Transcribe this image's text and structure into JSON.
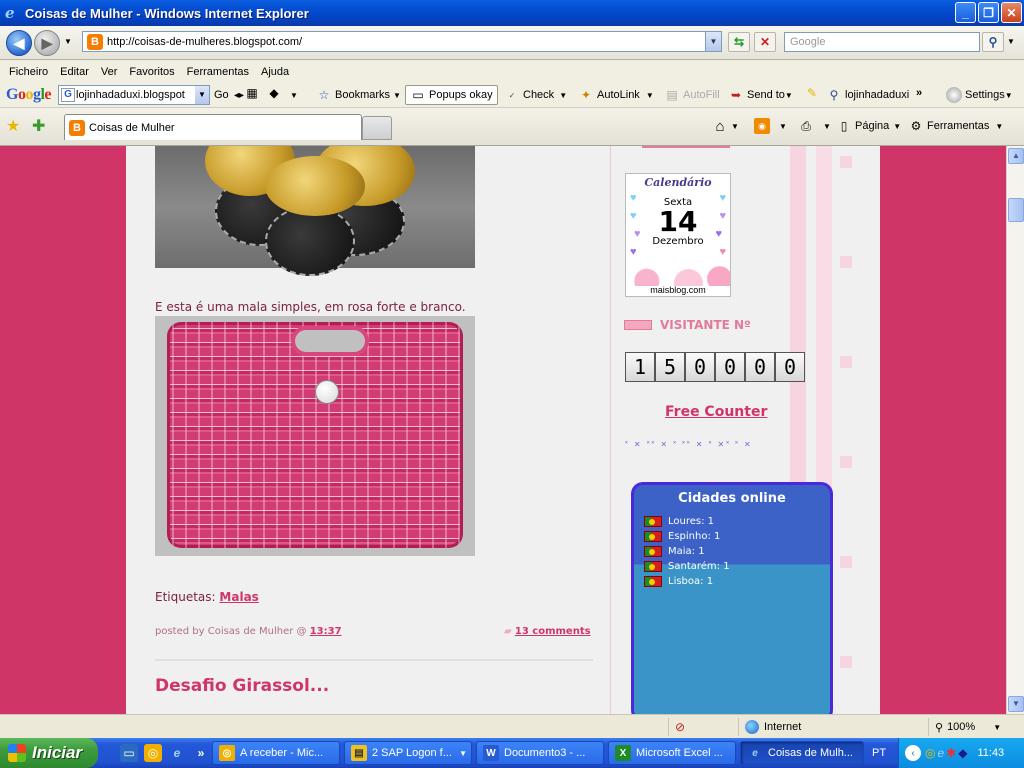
{
  "window": {
    "title": "Coisas de Mulher - Windows Internet Explorer",
    "controls": [
      "_",
      "❐",
      "✕"
    ]
  },
  "address_bar": {
    "url": "http://coisas-de-mulheres.blogspot.com/",
    "search_placeholder": "Google"
  },
  "menu": [
    "Ficheiro",
    "Editar",
    "Ver",
    "Favoritos",
    "Ferramentas",
    "Ajuda"
  ],
  "google_toolbar": {
    "logo": "Google",
    "combo_value": "lojinhadaduxi.blogspot",
    "go_label": "Go",
    "bookmarks_label": "Bookmarks",
    "popups_label": "Popups okay",
    "check_label": "Check",
    "autolink_label": "AutoLink",
    "autofill_label": "AutoFill",
    "sendto_label": "Send to",
    "profile_label": "lojinhadaduxi",
    "more_label": "»",
    "settings_label": "Settings"
  },
  "tabs": [
    {
      "label": "Coisas de Mulher",
      "active": true
    }
  ],
  "command_bar": {
    "page_label": "Página",
    "tools_label": "Ferramentas"
  },
  "post": {
    "caption": "E esta é uma mala simples, em rosa forte e branco.",
    "labels_prefix": "Etiquetas:",
    "label_link": "Malas",
    "posted_by": "posted by Coisas de Mulher @",
    "time": "13:37",
    "comments": "13 comments",
    "next_title": "Desafio Girassol..."
  },
  "sidebar": {
    "calendar": {
      "header": "Calendário",
      "weekday": "Sexta",
      "day": "14",
      "month": "Dezembro",
      "footer": "maisblog.com"
    },
    "visitor_label": "VISITANTE Nº",
    "counter_digits": [
      "1",
      "5",
      "0",
      "0",
      "0",
      "0"
    ],
    "free_counter": "Free Counter",
    "cidades_title": "Cidades online",
    "cidades": [
      "Loures: 1",
      "Espinho: 1",
      "Maia: 1",
      "Santarém: 1",
      "Lisboa: 1"
    ]
  },
  "status_bar": {
    "zone": "Internet",
    "zoom": "100%"
  },
  "taskbar": {
    "start_label": "Iniciar",
    "tasks": [
      {
        "label": "A receber - Mic...",
        "icon_color": "#f0b000"
      },
      {
        "label": "2 SAP Logon f...",
        "icon_color": "#f0c020"
      },
      {
        "label": "Documento3 - ...",
        "icon_color": "#2a5ad0"
      },
      {
        "label": "Microsoft Excel ...",
        "icon_color": "#1e8a2a"
      },
      {
        "label": "Coisas de Mulh...",
        "icon_color": "#2a7af0",
        "active": true
      }
    ],
    "language": "PT",
    "clock": "11:43"
  },
  "colors": {
    "page_background": "#d03568",
    "link": "#d03568",
    "content_background": "#f1f0f0"
  }
}
